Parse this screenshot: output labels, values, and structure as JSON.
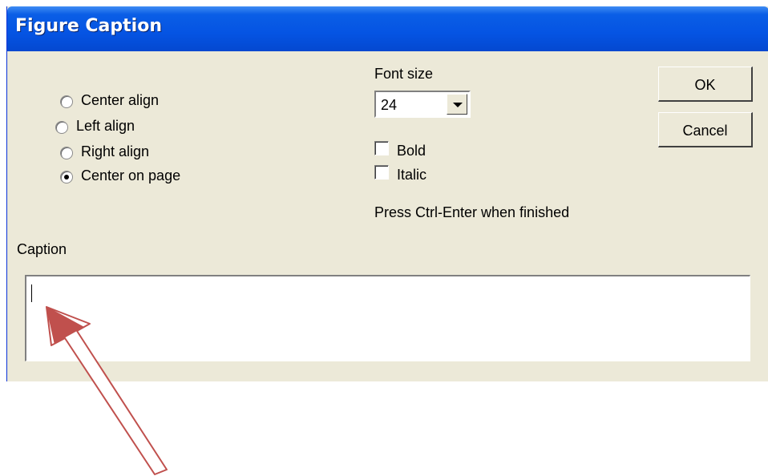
{
  "dialog": {
    "title": "Figure Caption",
    "alignment": {
      "options": [
        "Center align",
        "Left align",
        "Right align",
        "Center on page"
      ],
      "selected": "Center on page"
    },
    "font_size": {
      "label": "Font size",
      "value": "24"
    },
    "bold": {
      "label": "Bold",
      "checked": false
    },
    "italic": {
      "label": "Italic",
      "checked": false
    },
    "hint": "Press Ctrl-Enter when finished",
    "ok_label": "OK",
    "cancel_label": "Cancel",
    "caption": {
      "label": "Caption",
      "value": ""
    }
  },
  "annotation": {
    "arrow_color": "#c0504d"
  }
}
